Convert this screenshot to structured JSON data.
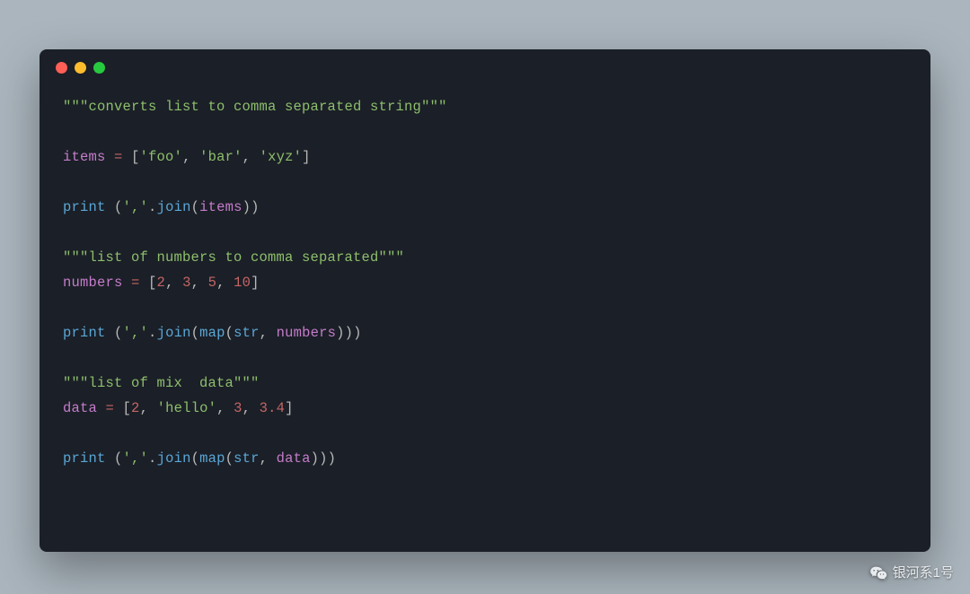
{
  "code": {
    "line1": {
      "docstring": "\"\"\"converts list to comma separated string\"\"\""
    },
    "line3": {
      "ident": "items",
      "eq": " = ",
      "items": [
        "'foo'",
        "'bar'",
        "'xyz'"
      ]
    },
    "line5": {
      "fn_print": "print",
      "open": " (",
      "comma_str": "','",
      "dot": ".",
      "fn_join": "join",
      "arg_open": "(",
      "arg": "items",
      "close": "))"
    },
    "line7": {
      "docstring": "\"\"\"list of numbers to comma separated\"\"\""
    },
    "line8": {
      "ident": "numbers",
      "eq": " = ",
      "nums": [
        "2",
        "3",
        "5",
        "10"
      ]
    },
    "line10": {
      "fn_print": "print",
      "open": " (",
      "comma_str": "','",
      "dot": ".",
      "fn_join": "join",
      "arg_open": "(",
      "fn_map": "map",
      "map_open": "(",
      "fn_str": "str",
      "sep": ", ",
      "arg": "numbers",
      "close": ")))"
    },
    "line12": {
      "docstring": "\"\"\"list of mix  data\"\"\""
    },
    "line13": {
      "ident": "data",
      "eq": " = ",
      "items": [
        {
          "type": "num",
          "v": "2"
        },
        {
          "type": "str",
          "v": "'hello'"
        },
        {
          "type": "num",
          "v": "3"
        },
        {
          "type": "num",
          "v": "3.4"
        }
      ]
    },
    "line15": {
      "fn_print": "print",
      "open": " (",
      "comma_str": "','",
      "dot": ".",
      "fn_join": "join",
      "arg_open": "(",
      "fn_map": "map",
      "map_open": "(",
      "fn_str": "str",
      "sep": ", ",
      "arg": "data",
      "close": ")))"
    }
  },
  "watermark": "银河系1号"
}
